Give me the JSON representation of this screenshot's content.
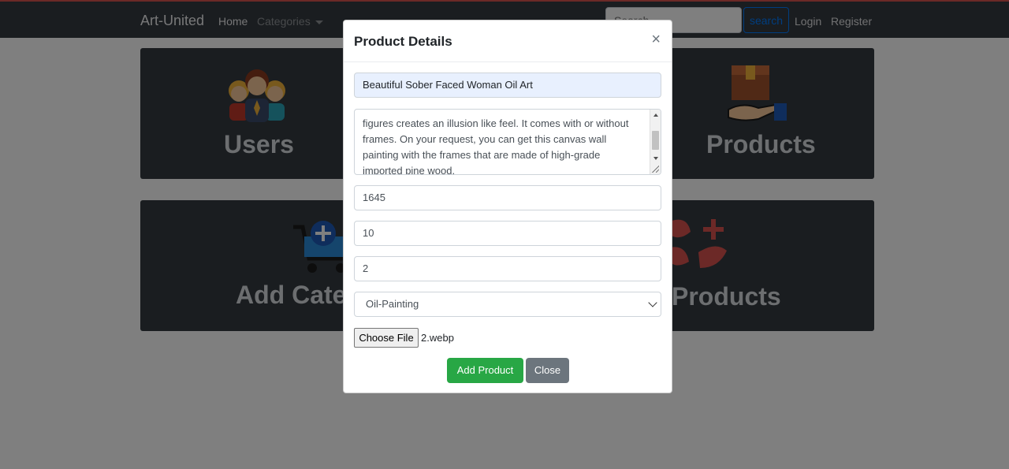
{
  "navbar": {
    "brand": "Art-United",
    "home": "Home",
    "categories": "Categories",
    "search_placeholder": "Search",
    "search_button": "search",
    "login": "Login",
    "register": "Register"
  },
  "cards": [
    {
      "label": "Users",
      "icon": "users-group-icon"
    },
    {
      "label": "Products",
      "icon": "product-box-hand-icon"
    },
    {
      "label": "Add Cate",
      "icon": "add-cart-icon"
    },
    {
      "label": "Products",
      "icon": "add-product-leaf-icon"
    }
  ],
  "modal": {
    "title": "Product Details",
    "close_glyph": "×",
    "product_name": "Beautiful Sober Faced Woman Oil Art",
    "description_lines": [
      "figures creates an illusion like feel. It comes with or without",
      "frames. On your request, you can get this canvas wall",
      "painting with the frames that are made of high-grade",
      "imported pine wood."
    ],
    "price": "1645",
    "quantity": "10",
    "discount": "2",
    "category_selected": "Oil-Painting",
    "file_button": "Choose File",
    "file_name": "2.webp",
    "add_button": "Add Product",
    "close_button": "Close"
  },
  "colors": {
    "navbar_bg": "#343a40",
    "card_bg": "#343a40",
    "add_button": "#28a745",
    "close_button": "#6c757d",
    "search_button": "#007bff"
  }
}
